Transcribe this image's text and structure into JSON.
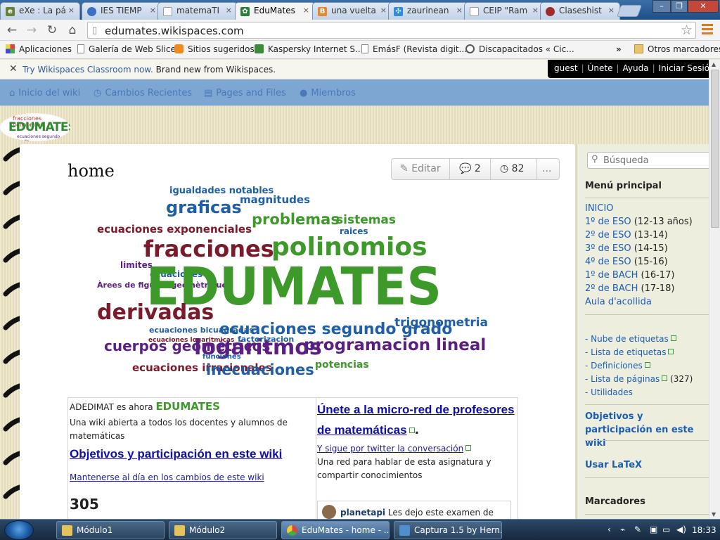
{
  "browser": {
    "tabs": [
      {
        "label": "eXe : La pá",
        "icon": "exe-icon",
        "color": "#6a7f3a"
      },
      {
        "label": "IES TIEMP",
        "icon": "globe-icon",
        "color": "#3b6fc4"
      },
      {
        "label": "matemaTI",
        "icon": "page-icon",
        "color": "#8a8a8a"
      },
      {
        "label": "EduMates",
        "icon": "wikispaces-icon",
        "color": "#2d7d3a",
        "active": true
      },
      {
        "label": "una vuelta",
        "icon": "blogger-icon",
        "color": "#f0822a"
      },
      {
        "label": "zaurinean",
        "icon": "pinwheel-icon",
        "color": "#2c8fd6"
      },
      {
        "label": "CEIP \"Ram",
        "icon": "page-icon",
        "color": "#8a8a8a"
      },
      {
        "label": "Claseshist",
        "icon": "site-icon",
        "color": "#a02b2b"
      }
    ],
    "close_glyph": "×",
    "url": "edumates.wikispaces.com",
    "bookmarks": [
      {
        "label": "Aplicaciones",
        "icon": "apps-grid-icon"
      },
      {
        "label": "Galería de Web Slice",
        "icon": "page-icon"
      },
      {
        "label": "Sitios sugeridos",
        "icon": "suggested-sites-icon"
      },
      {
        "label": "Kaspersky Internet S...",
        "icon": "kaspersky-icon"
      },
      {
        "label": "EmásF (Revista digit...",
        "icon": "page-icon"
      },
      {
        "label": "Discapacitados « Cic...",
        "icon": "wordpress-icon"
      }
    ],
    "bookmarks_overflow": "»",
    "other_bookmarks": "Otros marcadores"
  },
  "notice": {
    "link": "Try Wikispaces Classroom now.",
    "text": " Brand new from Wikispaces."
  },
  "userbar": {
    "items": [
      "guest",
      "Únete",
      "Ayuda",
      "Iniciar Sesión"
    ],
    "separator": "|"
  },
  "sitenav": {
    "items": [
      {
        "label": "Inicio del wiki",
        "icon": "home-icon"
      },
      {
        "label": "Cambios Recientes",
        "icon": "clock-icon"
      },
      {
        "label": "Pages and Files",
        "icon": "file-icon"
      },
      {
        "label": "Miembros",
        "icon": "user-icon"
      }
    ]
  },
  "logo": {
    "word_main": "EDUMATES",
    "word_top": "fracciones polinomios",
    "word_bottom": "ecuaciones segundo grado"
  },
  "page": {
    "title": "home",
    "edit_label": "Editar",
    "comments_count": "2",
    "history_count": "82",
    "more_label": "..."
  },
  "cloud_words": [
    {
      "text": "igualdades notables",
      "color": "#1f5fa8",
      "size": 13
    },
    {
      "text": "graficas",
      "color": "#1f5fa8",
      "size": 24
    },
    {
      "text": "magnitudes",
      "color": "#1f5fa8",
      "size": 15
    },
    {
      "text": "problemas",
      "color": "#3d9a2a",
      "size": 21
    },
    {
      "text": "sistemas",
      "color": "#3d9a2a",
      "size": 17
    },
    {
      "text": "ecuaciones exponenciales",
      "color": "#7a1a2a",
      "size": 15
    },
    {
      "text": "raices",
      "color": "#1f5fa8",
      "size": 12
    },
    {
      "text": "fracciones",
      "color": "#7a1a2a",
      "size": 32
    },
    {
      "text": "polinomios",
      "color": "#3d9a2a",
      "size": 36
    },
    {
      "text": "limites",
      "color": "#5b1f82",
      "size": 12
    },
    {
      "text": "ecuaciones",
      "color": "#1f5fa8",
      "size": 12
    },
    {
      "text": "Àrees de figures geomètriques",
      "color": "#5b1f82",
      "size": 11
    },
    {
      "text": "EDUMATES",
      "color": "#3d9a2a",
      "size": 74
    },
    {
      "text": "derivadas",
      "color": "#7a1a2a",
      "size": 30
    },
    {
      "text": "ecuaciones bicuadradas",
      "color": "#1f5fa8",
      "size": 11
    },
    {
      "text": "ecuaciones logaritmicas",
      "color": "#7a1a2a",
      "size": 9
    },
    {
      "text": "ecuaciones segundo grado",
      "color": "#1f5fa8",
      "size": 22
    },
    {
      "text": "trigonometria",
      "color": "#1f5fa8",
      "size": 17
    },
    {
      "text": "cuerpos geométricos",
      "color": "#5b1f82",
      "size": 20
    },
    {
      "text": "logaritmos",
      "color": "#5b1f82",
      "size": 30
    },
    {
      "text": "programacion lineal",
      "color": "#5b1f82",
      "size": 23
    },
    {
      "text": "factorizacion",
      "color": "#1f5fa8",
      "size": 11
    },
    {
      "text": "funciones",
      "color": "#1f5fa8",
      "size": 10
    },
    {
      "text": "potencias",
      "color": "#3d9a2a",
      "size": 14
    },
    {
      "text": "ecuaciones irracionales",
      "color": "#7a1a2a",
      "size": 15
    },
    {
      "text": "inecuaciones",
      "color": "#1f5fa8",
      "size": 21
    }
  ],
  "left_col": {
    "intro": "ADEDIMAT es ahora ",
    "intro_brand": "EDUMATES",
    "desc": "Una wiki abierta a todos los docentes y alumnos de matemáticas",
    "objectives_link": "Objetivos y participación en este wiki",
    "changes_link": "Mantenerse al día en los cambios de este wiki",
    "counter_partial": "305"
  },
  "right_col": {
    "join_link": "Únete a la micro-red de profesores de matemáticas",
    "join_period": ".",
    "twitter_link": "Y sigue por twitter la conversación",
    "desc": "Una red para hablar de esta asignatura y compartir conocimientos",
    "feed_user": "planetapi",
    "feed_text": " Les dejo este examen de"
  },
  "sidebar": {
    "search_placeholder": "Búsqueda",
    "menu_title": "Menú principal",
    "menu": [
      {
        "label": "INICIO",
        "age": ""
      },
      {
        "label": "1º de ESO",
        "age": " (12-13 años)"
      },
      {
        "label": "2º de ESO",
        "age": " (13-14)"
      },
      {
        "label": "3º de ESO",
        "age": " (14-15)"
      },
      {
        "label": "4º de ESO",
        "age": " (15-16)"
      },
      {
        "label": "1º de BACH",
        "age": " (16-17)"
      },
      {
        "label": "2º de BACH",
        "age": " (17-18)"
      },
      {
        "label": "Aula d'acollida",
        "age": ""
      }
    ],
    "tools": [
      {
        "label": "- Nube de etiquetas",
        "count": ""
      },
      {
        "label": "- Lista de etiquetas",
        "count": ""
      },
      {
        "label": "- Definiciones",
        "count": ""
      },
      {
        "label": "- Lista de páginas",
        "count": " (327)"
      },
      {
        "label": "- Utilidades",
        "count": ""
      }
    ],
    "objectives": "Objetivos y participación en este wiki",
    "latex": "Usar LaTeX",
    "bookmarks_title": "Marcadores"
  },
  "taskbar": {
    "tasks": [
      {
        "label": "Módulo1",
        "icon": "folder-icon"
      },
      {
        "label": "Módulo2",
        "icon": "folder-icon"
      },
      {
        "label": "EduMates - home - ...",
        "icon": "chrome-icon",
        "active": true
      },
      {
        "label": "Captura 1.5 by Hern...",
        "icon": "capture-icon"
      }
    ],
    "clock": "18:33"
  },
  "colors": {
    "nav_bar": "#7ea6d3",
    "link": "#1b5cb5",
    "brand_green": "#3d9a2a"
  }
}
